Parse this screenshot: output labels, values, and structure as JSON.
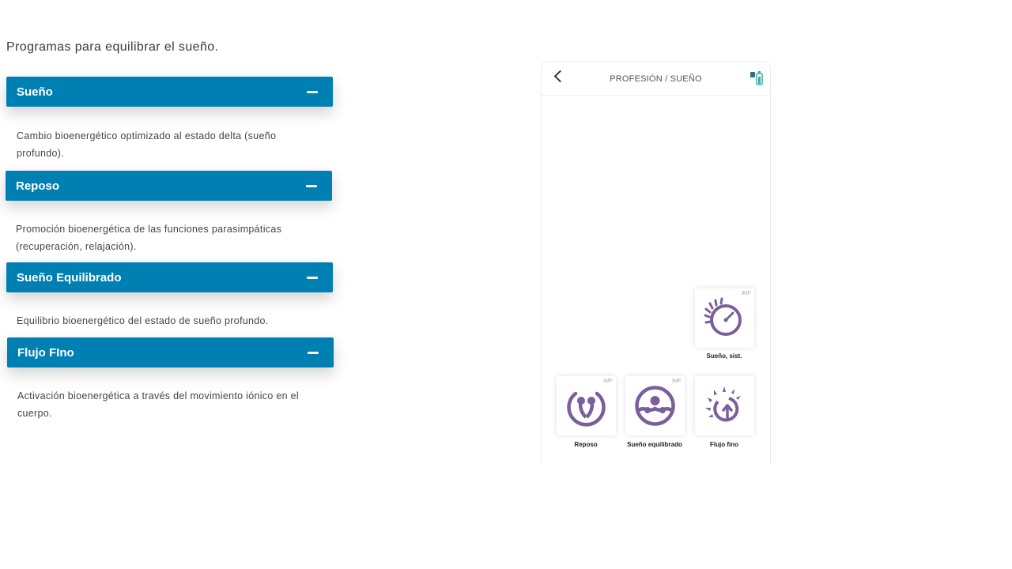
{
  "intro": "Programas para equilibrar el sueño.",
  "accordion": [
    {
      "title": "Sueño",
      "body": "Cambio bioenergético optimizado al estado delta (sueño profundo)."
    },
    {
      "title": "Reposo",
      "body": "Promoción bioenergética de las funciones parasimpáticas (recuperación, relajación)."
    },
    {
      "title": "Sueño Equilibrado",
      "body": "Equilibrio bioenergético del estado de sueño profundo."
    },
    {
      "title": "Flujo FIno",
      "body": "Activación bioenergética a través del movimiento iónico en el cuerpo."
    }
  ],
  "phone": {
    "title": "PROFESIÓN / SUEÑO",
    "tiles": [
      {
        "label": "Sueño, sist.",
        "badge": "IMF",
        "icon": "sleep-sun-clock-icon"
      },
      {
        "label": "Reposo",
        "badge": "IMF",
        "icon": "rest-drops-icon"
      },
      {
        "label": "Sueño equilibrado",
        "badge": "IMF",
        "icon": "balanced-sleep-icon"
      },
      {
        "label": "Flujo fino",
        "badge": "",
        "icon": "fine-flow-sun-icon"
      }
    ]
  },
  "colors": {
    "accent": "#0080b2",
    "icon": "#7a5f9a"
  }
}
